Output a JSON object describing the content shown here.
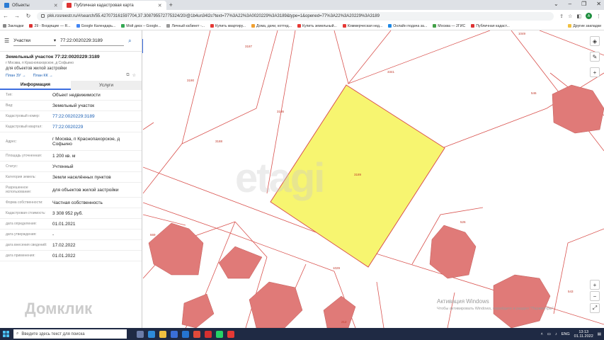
{
  "browser": {
    "tabs": [
      {
        "label": "Объекты"
      },
      {
        "label": "Публичная кадастровая карта"
      }
    ],
    "new_tab": "+",
    "url": "pkk.rosreestr.ru/#/search/55.42707316159770​4,37.30879557277532​4/20/@1b4un34l2s?text=77%3A22%3A0020229%3A3189&type=1&opened=77%3A22%3A20229%3A3189",
    "avatar": "A"
  },
  "bookmarks": [
    "Закладки",
    "29 - Входящие — R...",
    "Google Календарь...",
    "Мой диск – Google...",
    "Личный кабинет -...",
    "Купить квартиру...",
    "Дома, дачи, коттед...",
    "Купить земельный...",
    "Коммерческая нед...",
    "Онлайн подача за...",
    "Москва — 2ГИС",
    "Публичная кадаст..."
  ],
  "bookmarks_other": "Другие закладки",
  "panel": {
    "search_type": "Участки",
    "search_value": "77:22:0020229:3189",
    "title": "Земельный участок 77:22:0020229:3189",
    "address_short": "г Москва, п Краснопахорское, д Софьино",
    "purpose": "для объектов жилой застройки",
    "plan_zu": "План ЗУ →",
    "plan_kk": "План КК →",
    "tab_info": "Информация",
    "tab_services": "Услуги",
    "rows": [
      {
        "label": "Тип:",
        "value": "Объект недвижимости",
        "link": false
      },
      {
        "label": "Вид:",
        "value": "Земельный участок",
        "link": false
      },
      {
        "label": "Кадастровый номер:",
        "value": "77:22:0020229:3189",
        "link": true
      },
      {
        "label": "Кадастровый квартал:",
        "value": "77:22:0020229",
        "link": true
      },
      {
        "label": "Адрес:",
        "value": "г Москва, п Краснопахорское, д Софьино",
        "link": false
      },
      {
        "label": "Площадь уточненная:",
        "value": "1 200 кв. м",
        "link": false
      },
      {
        "label": "Статус:",
        "value": "Учтенный",
        "link": false
      },
      {
        "label": "Категория земель:",
        "value": "Земли населённых пунктов",
        "link": false
      },
      {
        "label": "Разрешенное использование:",
        "value": "для объектов жилой застройки",
        "link": false
      },
      {
        "label": "Форма собственности:",
        "value": "Частная собственность",
        "link": false
      },
      {
        "label": "Кадастровая стоимость:",
        "value": "3 308 952 руб.",
        "link": false
      },
      {
        "label": "дата определения:",
        "value": "01.01.2021",
        "link": false
      },
      {
        "label": "дата утверждения:",
        "value": "-",
        "link": false
      },
      {
        "label": "дата внесения сведений:",
        "value": "17.02.2022",
        "link": false
      },
      {
        "label": "дата применения:",
        "value": "01.01.2022",
        "link": false
      }
    ]
  },
  "map": {
    "watermark": "etagi",
    "plot_labels": [
      "3187",
      "3186",
      "3188",
      "3341",
      "3189",
      "1029",
      "1049",
      "546",
      "526",
      "669",
      "543",
      "3190",
      "212"
    ],
    "activation_title": "Активация Windows",
    "activation_sub": "Чтобы активировать Windows, перейдите в раздел \"Параметры\".",
    "domklik": "Домклик",
    "highlight_color": "#f7f570",
    "building_color": "#e07a78"
  },
  "taskbar": {
    "search_placeholder": "Введите здесь текст для поиска",
    "lang": "ENG",
    "time": "13:13",
    "date": "01.11.2022"
  }
}
